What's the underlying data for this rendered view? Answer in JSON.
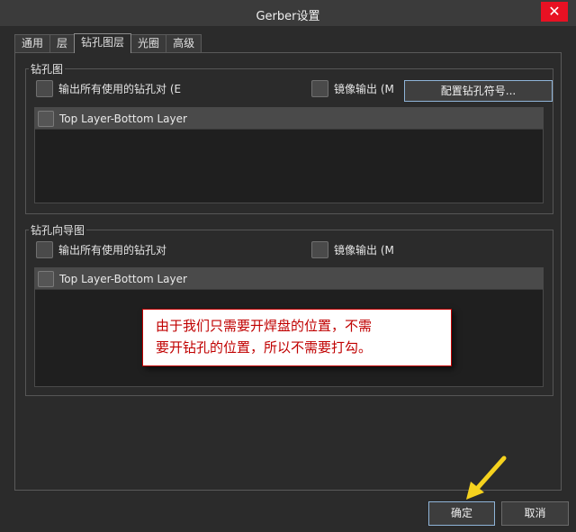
{
  "window": {
    "title": "Gerber设置",
    "close_icon": "close-icon"
  },
  "tabs": [
    {
      "label": "通用",
      "active": false
    },
    {
      "label": "层",
      "active": false
    },
    {
      "label": "钻孔图层",
      "active": true
    },
    {
      "label": "光圈",
      "active": false
    },
    {
      "label": "高级",
      "active": false
    }
  ],
  "drill_drawing": {
    "legend": "钻孔图",
    "output_all_label": "输出所有使用的钻孔对 (E",
    "mirror_label": "镜像输出 (M",
    "configure_button": "配置钻孔符号...",
    "layer_pairs": [
      "Top Layer-Bottom Layer"
    ]
  },
  "drill_guide": {
    "legend": "钻孔向导图",
    "output_all_label": "输出所有使用的钻孔对",
    "mirror_label": "镜像输出 (M",
    "layer_pairs": [
      "Top Layer-Bottom Layer"
    ]
  },
  "annotation": {
    "line1": "由于我们只需要开焊盘的位置，不需",
    "line2": "要开钻孔的位置，所以不需要打勾。",
    "arrow_color": "#f5d21e",
    "text_color": "#c00000"
  },
  "footer": {
    "ok_label": "确定",
    "cancel_label": "取消"
  }
}
